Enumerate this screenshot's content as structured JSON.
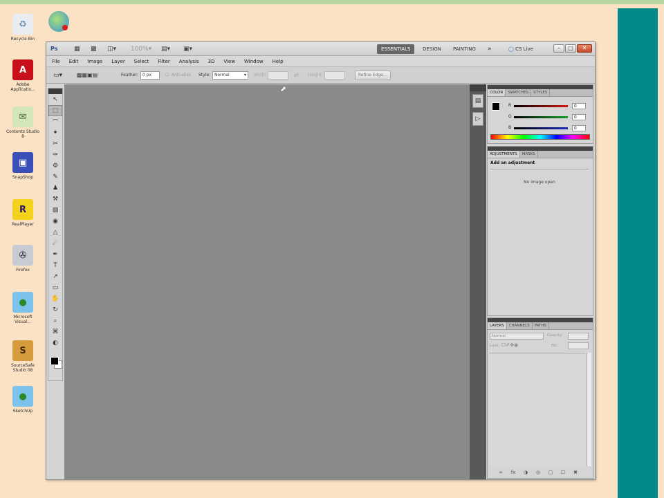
{
  "desktop": {
    "icons": [
      {
        "label": "Recycle Bin",
        "glyph": "♻",
        "color": "#6d8fb3",
        "bg": "#e9edf2"
      },
      {
        "label": "Adobe Applicatio...",
        "glyph": "A",
        "color": "#ffffff",
        "bg": "#c8101a"
      },
      {
        "label": "Contents Studio 8",
        "glyph": "✉",
        "color": "#4a6d3a",
        "bg": "#d3e7b8"
      },
      {
        "label": "SnapShop",
        "glyph": "▣",
        "color": "#ffffff",
        "bg": "#3b4fb8"
      },
      {
        "label": "RealPlayer",
        "glyph": "R",
        "color": "#2a1a6a",
        "bg": "#f2d21b"
      },
      {
        "label": "Firefox",
        "glyph": "✇",
        "color": "#222222",
        "bg": "#c7ccd4"
      },
      {
        "label": "Microsoft Visual...",
        "glyph": "●",
        "color": "#2a8a2a",
        "bg": "#7bc3ea"
      },
      {
        "label": "SourceSafe Studio 08",
        "glyph": "S",
        "color": "#4a2a08",
        "bg": "#d69b3d"
      },
      {
        "label": "SketchUp",
        "glyph": "●",
        "color": "#2a8a2a",
        "bg": "#7bc3ea"
      }
    ],
    "top_icon_glyph": "●"
  },
  "titlebar": {
    "app_icon": "Ps",
    "workspaces": [
      "ESSENTIALS",
      "DESIGN",
      "PAINTING"
    ],
    "more": "»",
    "cs_live": "CS Live"
  },
  "menubar": [
    "File",
    "Edit",
    "Image",
    "Layer",
    "Select",
    "Filter",
    "Analysis",
    "3D",
    "View",
    "Window",
    "Help"
  ],
  "options": {
    "feather_label": "Feather:",
    "feather_value": "0 px",
    "antialias_label": "Anti-alias",
    "style_label": "Style:",
    "style_value": "Normal",
    "width_label": "Width:",
    "height_label": "Height:",
    "refine_edge": "Refine Edge..."
  },
  "tools": [
    "↖",
    "⬚",
    "⌒",
    "✦",
    "✂",
    "✑",
    "⚙",
    "✎",
    "♟",
    "⚒",
    "▧",
    "◉",
    "△",
    "☄",
    "✒",
    "T",
    "↗",
    "▭",
    "✋",
    "↻",
    "⌕",
    "⌘",
    "◐"
  ],
  "color_panel": {
    "tabs": [
      "COLOR",
      "SWATCHES",
      "STYLES"
    ],
    "channels": [
      {
        "name": "R",
        "value": "0",
        "color": "#d21616"
      },
      {
        "name": "G",
        "value": "0",
        "color": "#159a2a"
      },
      {
        "name": "B",
        "value": "0",
        "color": "#1a2ab8"
      }
    ]
  },
  "adjustments_panel": {
    "tabs": [
      "ADJUSTMENTS",
      "MASKS"
    ],
    "heading": "Add an adjustment",
    "message": "No image open"
  },
  "layers_panel": {
    "tabs": [
      "LAYERS",
      "CHANNELS",
      "PATHS"
    ],
    "blend_mode": "Normal",
    "opacity_label": "Opacity:",
    "lock_label": "Lock:",
    "fill_label": "Fill:",
    "bottom_icons": [
      "∞",
      "fx",
      "◑",
      "◎",
      "▢",
      "☐",
      "✖"
    ]
  }
}
